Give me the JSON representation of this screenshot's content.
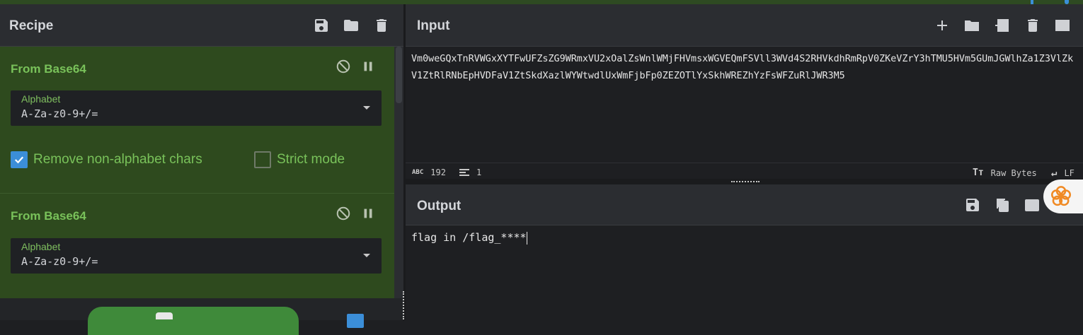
{
  "recipe": {
    "title": "Recipe",
    "operations": [
      {
        "name": "From Base64",
        "alphabet_label": "Alphabet",
        "alphabet_value": "A-Za-z0-9+/=",
        "remove_non_alphabet": {
          "label": "Remove non-alphabet chars",
          "checked": true
        },
        "strict_mode": {
          "label": "Strict mode",
          "checked": false
        }
      },
      {
        "name": "From Base64",
        "alphabet_label": "Alphabet",
        "alphabet_value": "A-Za-z0-9+/="
      }
    ]
  },
  "input": {
    "title": "Input",
    "text": "Vm0weGQxTnRVWGxXYTFwUFZsZG9WRmxVU2xOalZsWnlWMjFHVmsxWGVEQmFSVll3WVd4S2RHVkdhRmRpV0ZKeVZrY3hTMU5HVm5GUmJGWlhZa1Z3VlZkV1ZtRlRNbEpHVDFaV1ZtSkdXazlWYWtwdlUxWmFjbFp0ZEZOTlYxSkhWREZhYzFsWFZuRlJWR3M5",
    "status": {
      "chars": "192",
      "lines": "1",
      "encoding": "Raw Bytes",
      "eol": "LF",
      "chars_icon": "ABC"
    }
  },
  "output": {
    "title": "Output",
    "text": "flag in /flag_****"
  },
  "colors": {
    "accent": "#3b8ed8",
    "op_bg": "#2e4a1e",
    "op_text": "#79c25a",
    "bake": "#3f8a3a"
  }
}
